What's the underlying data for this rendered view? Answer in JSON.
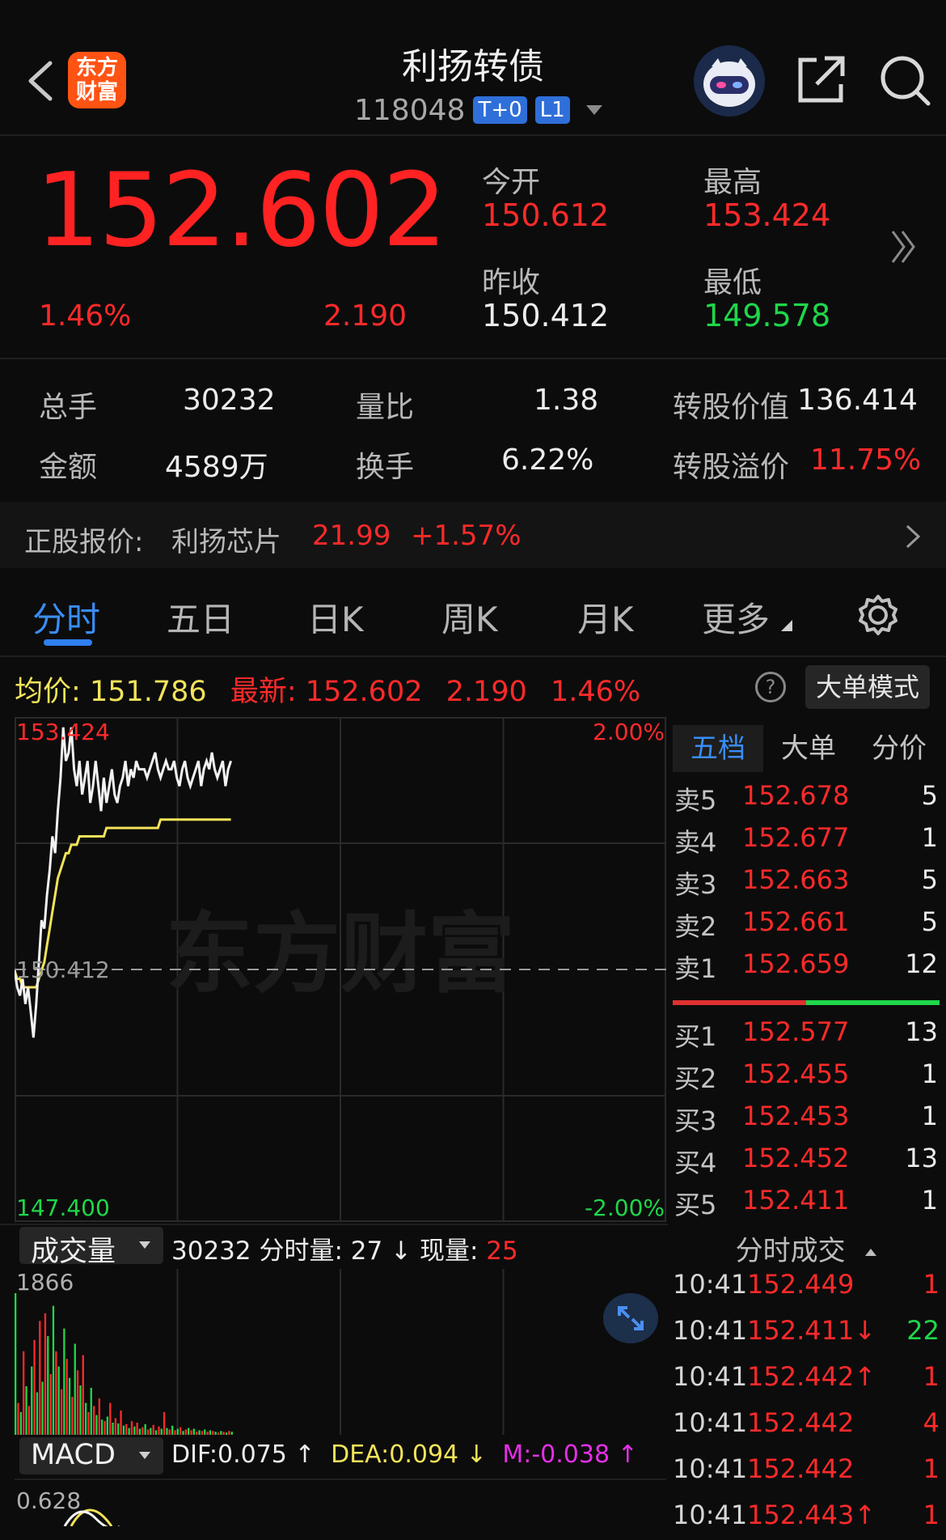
{
  "header": {
    "logo_line1": "东方",
    "logo_line2": "财富",
    "title": "利扬转债",
    "code": "118048",
    "tags": [
      "T+0",
      "L1"
    ]
  },
  "quote": {
    "price": "152.602",
    "change_pct": "1.46%",
    "change": "2.190",
    "open_label": "今开",
    "open": "150.612",
    "high_label": "最高",
    "high": "153.424",
    "prev_close_label": "昨收",
    "prev_close": "150.412",
    "low_label": "最低",
    "low": "149.578"
  },
  "stats": {
    "volume_label": "总手",
    "volume": "30232",
    "vol_ratio_label": "量比",
    "vol_ratio": "1.38",
    "conv_value_label": "转股价值",
    "conv_value": "136.414",
    "amount_label": "金额",
    "amount": "4589万",
    "turnover_label": "换手",
    "turnover": "6.22%",
    "premium_label": "转股溢价",
    "premium": "11.75%"
  },
  "stock": {
    "label": "正股报价:",
    "name": "利扬芯片",
    "price": "21.99",
    "change": "+1.57%"
  },
  "tabs": [
    "分时",
    "五日",
    "日K",
    "周K",
    "月K",
    "更多"
  ],
  "info": {
    "avg_label": "均价:",
    "avg": "151.786",
    "latest_label": "最新:",
    "latest": "152.602",
    "change": "2.190",
    "pct": "1.46%",
    "help": "?",
    "big_order_mode": "大单模式"
  },
  "chart_data": {
    "type": "line",
    "ylim": [
      147.4,
      153.424
    ],
    "y_top_label": "153.424",
    "y_bottom_label": "147.400",
    "pct_top": "2.00%",
    "pct_bottom": "-2.00%",
    "ref_label": "150.412",
    "ref_value": 150.412,
    "watermark": "东方财富",
    "series": [
      {
        "values": [
          150.4,
          150.2,
          150.1,
          150.3,
          150.0,
          150.2,
          149.9,
          149.6,
          150.0,
          150.5,
          151.0,
          150.9,
          151.3,
          151.6,
          152.0,
          151.8,
          152.3,
          152.7,
          153.3,
          152.9,
          153.0,
          153.3,
          152.8,
          152.6,
          152.9,
          152.5,
          152.7,
          152.9,
          152.4,
          152.6,
          152.9,
          152.6,
          152.3,
          152.7,
          152.4,
          152.6,
          152.8,
          152.5,
          152.4,
          152.6,
          152.7,
          152.9,
          152.6,
          152.8,
          152.7,
          152.9,
          152.8,
          152.8,
          152.8,
          152.7,
          152.8,
          152.9,
          153.0,
          152.8,
          152.7,
          152.8,
          152.9,
          152.8,
          152.8,
          152.9,
          152.7,
          152.6,
          152.8,
          152.9,
          152.7,
          152.6,
          152.7,
          152.8,
          152.9,
          152.6,
          152.8,
          152.9,
          152.8,
          153.0,
          152.8,
          152.7,
          152.8,
          152.9,
          152.6,
          152.8,
          152.9
        ]
      },
      {
        "values": [
          150.4,
          150.3,
          150.3,
          150.2,
          150.2,
          150.2,
          150.2,
          150.2,
          150.2,
          150.3,
          150.4,
          150.5,
          150.7,
          150.9,
          151.1,
          151.3,
          151.5,
          151.6,
          151.7,
          151.8,
          151.8,
          151.9,
          151.9,
          151.9,
          152.0,
          152.0,
          152.0,
          152.0,
          152.0,
          152.0,
          152.0,
          152.0,
          152.0,
          152.0,
          152.1,
          152.1,
          152.1,
          152.1,
          152.1,
          152.1,
          152.1,
          152.1,
          152.1,
          152.1,
          152.1,
          152.1,
          152.1,
          152.1,
          152.1,
          152.1,
          152.1,
          152.1,
          152.1,
          152.1,
          152.2,
          152.2,
          152.2,
          152.2,
          152.2,
          152.2,
          152.2,
          152.2,
          152.2,
          152.2,
          152.2,
          152.2,
          152.2,
          152.2,
          152.2,
          152.2,
          152.2,
          152.2,
          152.2,
          152.2,
          152.2,
          152.2,
          152.2,
          152.2,
          152.2,
          152.2,
          152.2
        ]
      }
    ]
  },
  "order_book": {
    "tabs": [
      "五档",
      "大单",
      "分价"
    ],
    "asks": [
      {
        "label": "卖5",
        "price": "152.678",
        "vol": "5"
      },
      {
        "label": "卖4",
        "price": "152.677",
        "vol": "1"
      },
      {
        "label": "卖3",
        "price": "152.663",
        "vol": "5"
      },
      {
        "label": "卖2",
        "price": "152.661",
        "vol": "5"
      },
      {
        "label": "卖1",
        "price": "152.659",
        "vol": "12"
      }
    ],
    "bids": [
      {
        "label": "买1",
        "price": "152.577",
        "vol": "13"
      },
      {
        "label": "买2",
        "price": "152.455",
        "vol": "1"
      },
      {
        "label": "买3",
        "price": "152.453",
        "vol": "1"
      },
      {
        "label": "买4",
        "price": "152.452",
        "vol": "13"
      },
      {
        "label": "买5",
        "price": "152.411",
        "vol": "1"
      }
    ],
    "buy_ratio": 0.5
  },
  "timesales": {
    "title": "分时成交",
    "rows": [
      {
        "time": "10:41",
        "price": "152.449",
        "arrow": "",
        "vol": "1",
        "vol_color": "#ff2a2a"
      },
      {
        "time": "10:41",
        "price": "152.411",
        "arrow": "↓",
        "vol": "22",
        "vol_color": "#1ed74a"
      },
      {
        "time": "10:41",
        "price": "152.442",
        "arrow": "↑",
        "vol": "1",
        "vol_color": "#ff2a2a"
      },
      {
        "time": "10:41",
        "price": "152.442",
        "arrow": "",
        "vol": "4",
        "vol_color": "#ff2a2a"
      },
      {
        "time": "10:41",
        "price": "152.442",
        "arrow": "",
        "vol": "1",
        "vol_color": "#ff2a2a"
      },
      {
        "time": "10:41",
        "price": "152.443",
        "arrow": "↑",
        "vol": "1",
        "vol_color": "#ff2a2a"
      }
    ]
  },
  "volume": {
    "select": "成交量",
    "total": "30232",
    "minute_label": "分时量:",
    "minute": "27",
    "arrow": "↓",
    "now_label": "现量:",
    "now": "25",
    "max_label": "1866",
    "bars": [
      {
        "v": 1866,
        "c": "g"
      },
      {
        "v": 420,
        "c": "r"
      },
      {
        "v": 300,
        "c": "g"
      },
      {
        "v": 1100,
        "c": "r"
      },
      {
        "v": 640,
        "c": "g"
      },
      {
        "v": 380,
        "c": "r"
      },
      {
        "v": 900,
        "c": "g"
      },
      {
        "v": 1250,
        "c": "r"
      },
      {
        "v": 560,
        "c": "g"
      },
      {
        "v": 1500,
        "c": "r"
      },
      {
        "v": 700,
        "c": "g"
      },
      {
        "v": 1600,
        "c": "r"
      },
      {
        "v": 1300,
        "c": "g"
      },
      {
        "v": 800,
        "c": "r"
      },
      {
        "v": 1700,
        "c": "g"
      },
      {
        "v": 1100,
        "c": "r"
      },
      {
        "v": 900,
        "c": "g"
      },
      {
        "v": 600,
        "c": "r"
      },
      {
        "v": 1400,
        "c": "g"
      },
      {
        "v": 1000,
        "c": "r"
      },
      {
        "v": 750,
        "c": "g"
      },
      {
        "v": 500,
        "c": "r"
      },
      {
        "v": 1200,
        "c": "g"
      },
      {
        "v": 850,
        "c": "r"
      },
      {
        "v": 650,
        "c": "g"
      },
      {
        "v": 1050,
        "c": "r"
      },
      {
        "v": 420,
        "c": "g"
      },
      {
        "v": 300,
        "c": "r"
      },
      {
        "v": 620,
        "c": "g"
      },
      {
        "v": 380,
        "c": "r"
      },
      {
        "v": 260,
        "c": "g"
      },
      {
        "v": 480,
        "c": "r"
      },
      {
        "v": 200,
        "c": "g"
      },
      {
        "v": 180,
        "c": "r"
      },
      {
        "v": 240,
        "c": "g"
      },
      {
        "v": 420,
        "c": "r"
      },
      {
        "v": 160,
        "c": "g"
      },
      {
        "v": 220,
        "c": "r"
      },
      {
        "v": 150,
        "c": "g"
      },
      {
        "v": 320,
        "c": "r"
      },
      {
        "v": 120,
        "c": "g"
      },
      {
        "v": 140,
        "c": "r"
      },
      {
        "v": 90,
        "c": "g"
      },
      {
        "v": 180,
        "c": "r"
      },
      {
        "v": 110,
        "c": "g"
      },
      {
        "v": 160,
        "c": "r"
      },
      {
        "v": 80,
        "c": "g"
      },
      {
        "v": 100,
        "c": "r"
      },
      {
        "v": 140,
        "c": "g"
      },
      {
        "v": 70,
        "c": "r"
      },
      {
        "v": 90,
        "c": "g"
      },
      {
        "v": 130,
        "c": "r"
      },
      {
        "v": 60,
        "c": "g"
      },
      {
        "v": 110,
        "c": "r"
      },
      {
        "v": 80,
        "c": "g"
      },
      {
        "v": 300,
        "c": "r"
      },
      {
        "v": 90,
        "c": "g"
      },
      {
        "v": 70,
        "c": "r"
      },
      {
        "v": 120,
        "c": "g"
      },
      {
        "v": 60,
        "c": "r"
      },
      {
        "v": 80,
        "c": "g"
      },
      {
        "v": 100,
        "c": "r"
      },
      {
        "v": 50,
        "c": "g"
      },
      {
        "v": 70,
        "c": "r"
      },
      {
        "v": 90,
        "c": "g"
      },
      {
        "v": 60,
        "c": "r"
      },
      {
        "v": 80,
        "c": "g"
      },
      {
        "v": 40,
        "c": "r"
      },
      {
        "v": 60,
        "c": "g"
      },
      {
        "v": 50,
        "c": "r"
      },
      {
        "v": 70,
        "c": "g"
      },
      {
        "v": 40,
        "c": "r"
      },
      {
        "v": 60,
        "c": "g"
      },
      {
        "v": 50,
        "c": "r"
      },
      {
        "v": 40,
        "c": "g"
      },
      {
        "v": 30,
        "c": "r"
      },
      {
        "v": 50,
        "c": "g"
      },
      {
        "v": 40,
        "c": "r"
      },
      {
        "v": 30,
        "c": "g"
      },
      {
        "v": 50,
        "c": "r"
      },
      {
        "v": 40,
        "c": "g"
      }
    ]
  },
  "macd": {
    "select": "MACD",
    "dif": "DIF:0.075 ↑",
    "dea": "DEA:0.094 ↓",
    "m": "M:-0.038 ↑",
    "top_label": "0.628"
  },
  "colors": {
    "up": "#ff2a2a",
    "down": "#1ed74a",
    "accent": "#2f80f0",
    "avg": "#f2e35a"
  }
}
